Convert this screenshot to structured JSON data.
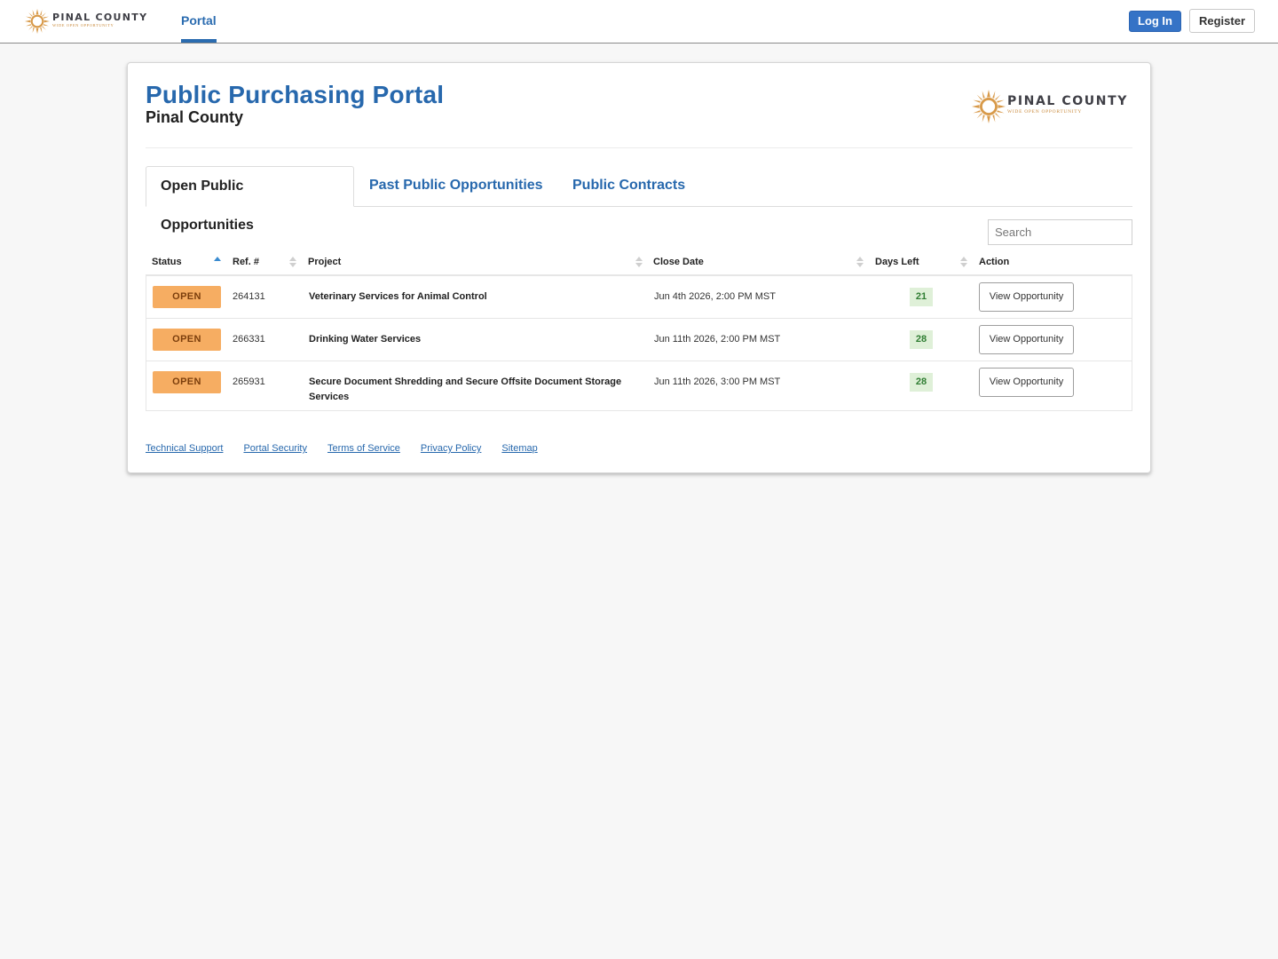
{
  "navbar": {
    "logo": {
      "name": "PINAL COUNTY",
      "tagline": "WIDE OPEN OPPORTUNITY",
      "icon": "sun-logo-icon"
    },
    "portal_link": "Portal",
    "login_label": "Log In",
    "register_label": "Register"
  },
  "header": {
    "title": "Public Purchasing Portal",
    "subtitle": "Pinal County",
    "logo": {
      "name": "PINAL COUNTY",
      "tagline": "WIDE OPEN OPPORTUNITY"
    }
  },
  "tabs": [
    {
      "label": "Open Public Opportunities",
      "active": true
    },
    {
      "label": "Past Public Opportunities",
      "active": false
    },
    {
      "label": "Public Contracts",
      "active": false
    }
  ],
  "search": {
    "placeholder": "Search",
    "value": ""
  },
  "table": {
    "columns": [
      "Status",
      "Ref. #",
      "Project",
      "Close Date",
      "Days Left",
      "Action"
    ],
    "sorted_column": "Status",
    "sort_direction": "ascending",
    "rows": [
      {
        "status": "OPEN",
        "ref": "264131",
        "project": "Veterinary Services for Animal Control",
        "close_date": "Jun 4th 2026, 2:00 PM MST",
        "days_left": "21",
        "action": "View Opportunity"
      },
      {
        "status": "OPEN",
        "ref": "266331",
        "project": "Drinking Water Services",
        "close_date": "Jun 11th 2026, 2:00 PM MST",
        "days_left": "28",
        "action": "View Opportunity"
      },
      {
        "status": "OPEN",
        "ref": "265931",
        "project": "Secure Document Shredding and Secure Offsite Document Storage Services",
        "close_date": "Jun 11th 2026, 3:00 PM MST",
        "days_left": "28",
        "action": "View Opportunity"
      }
    ]
  },
  "footer": {
    "links": [
      "Technical Support",
      "Portal Security",
      "Terms of Service",
      "Privacy Policy",
      "Sitemap"
    ]
  },
  "colors": {
    "brand_blue": "#2768ad",
    "login_button": "#3573c6",
    "open_badge": "#f6ad62",
    "days_badge_bg": "#dff0d8",
    "days_badge_text": "#2f7d32",
    "logo_gold": "#d89a4a"
  }
}
